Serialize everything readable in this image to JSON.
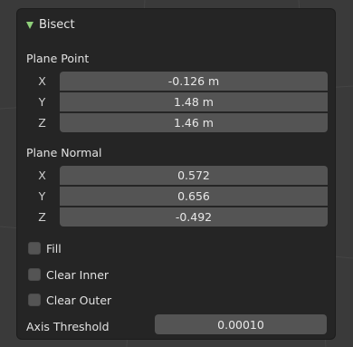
{
  "panel": {
    "title": "Bisect",
    "expand_icon": "triangle-down-icon",
    "accent_color": "#8fd07a"
  },
  "plane_point": {
    "label": "Plane Point",
    "x": {
      "axis": "X",
      "value": "-0.126 m"
    },
    "y": {
      "axis": "Y",
      "value": "1.48 m"
    },
    "z": {
      "axis": "Z",
      "value": "1.46 m"
    }
  },
  "plane_normal": {
    "label": "Plane Normal",
    "x": {
      "axis": "X",
      "value": "0.572"
    },
    "y": {
      "axis": "Y",
      "value": "0.656"
    },
    "z": {
      "axis": "Z",
      "value": "-0.492"
    }
  },
  "options": {
    "fill": {
      "label": "Fill",
      "checked": false
    },
    "clear_inner": {
      "label": "Clear Inner",
      "checked": false
    },
    "clear_outer": {
      "label": "Clear Outer",
      "checked": false
    }
  },
  "axis_threshold": {
    "label": "Axis Threshold",
    "value": "0.00010"
  }
}
